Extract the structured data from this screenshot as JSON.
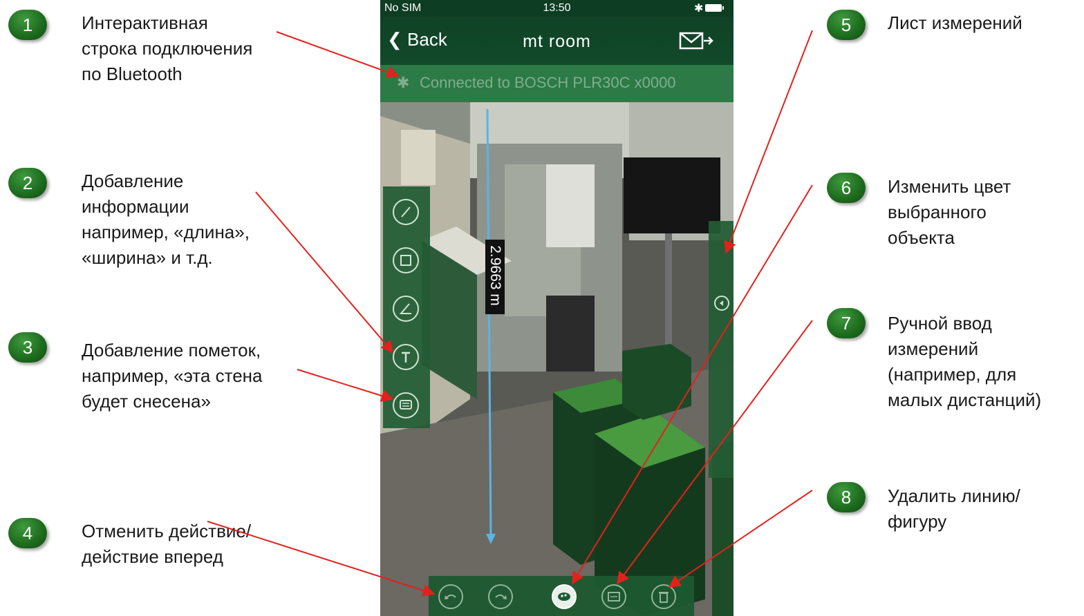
{
  "phone": {
    "status": {
      "carrier": "No SIM",
      "time": "13:50"
    },
    "nav": {
      "back_label": "Back",
      "title": "mt room"
    },
    "connection": {
      "text": "Connected to BOSCH PLR30C x0000"
    },
    "measurement": {
      "value": "2.9663 m"
    },
    "left_tools": [
      "line-tool-icon",
      "rectangle-tool-icon",
      "angle-tool-icon",
      "text-tool-icon",
      "comment-tool-icon"
    ],
    "bottom_tools": [
      "undo-icon",
      "redo-icon",
      "color-change-icon",
      "manual-entry-icon",
      "delete-icon"
    ]
  },
  "callouts": [
    {
      "num": "1",
      "lines": [
        "Интерактивная",
        "строка подключения",
        "по Bluetooth"
      ]
    },
    {
      "num": "2",
      "lines": [
        "Добавление",
        "информации",
        "например, «длина»,",
        "«ширина» и т.д."
      ]
    },
    {
      "num": "3",
      "lines": [
        "Добавление пометок,",
        "например,  «эта стена",
        "будет снесена»"
      ]
    },
    {
      "num": "4",
      "lines": [
        "Отменить действие/",
        "действие вперед"
      ]
    },
    {
      "num": "5",
      "lines": [
        "Лист измерений"
      ]
    },
    {
      "num": "6",
      "lines": [
        "Изменить цвет",
        "выбранного",
        "объекта"
      ]
    },
    {
      "num": "7",
      "lines": [
        "Ручной ввод",
        "измерений",
        "(например, для",
        "малых дистанций)"
      ]
    },
    {
      "num": "8",
      "lines": [
        "Удалить линию/",
        "фигуру"
      ]
    }
  ],
  "colors": {
    "badge": "#1f6e1f",
    "arrow": "#e3211c",
    "nav_bar": "#0f4226",
    "connection_bar": "#2c7a45"
  }
}
